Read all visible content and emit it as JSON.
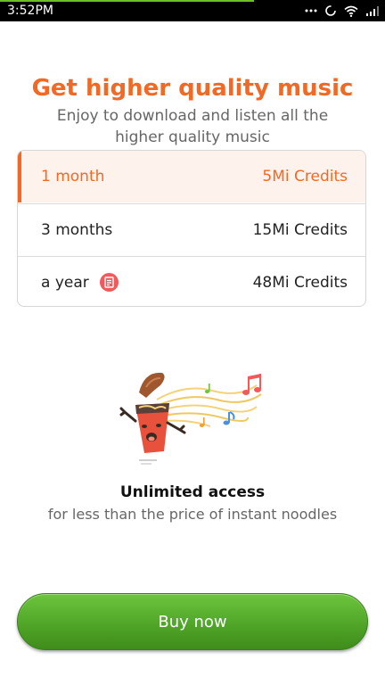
{
  "status_bar": {
    "time": "3:52PM",
    "progress_fraction": 0.66,
    "icons": [
      "more-dots-icon",
      "sync-icon",
      "wifi-icon",
      "signal-icon"
    ]
  },
  "header": {
    "title": "Get higher quality music",
    "subtitle": "Enjoy to download and listen all the higher quality music"
  },
  "plans": [
    {
      "label": "1 month",
      "price": "5Mi Credits",
      "selected": true
    },
    {
      "label": "3 months",
      "price": "15Mi Credits",
      "selected": false
    },
    {
      "label": "a year",
      "price": "48Mi Credits",
      "selected": false,
      "badge_icon": "deal-badge-icon"
    }
  ],
  "feature": {
    "title": "Unlimited access",
    "subtitle": "for less than the price of instant noodles",
    "illustration_icon": "noodle-cup-music-illustration"
  },
  "actions": {
    "buy_label": "Buy now"
  },
  "colors": {
    "accent": "#f16a25",
    "selected_row_bg": "#fdf2ec",
    "button_green": "#52a82a",
    "badge_red": "#f05a5a"
  }
}
